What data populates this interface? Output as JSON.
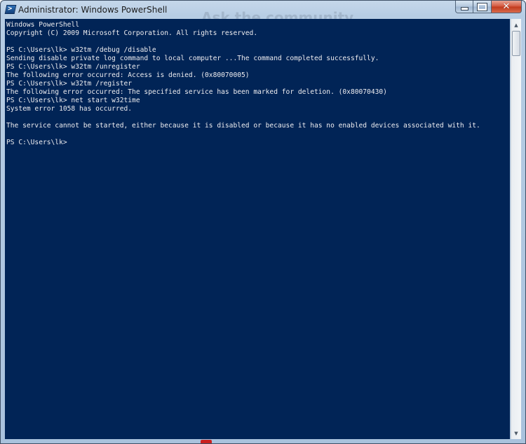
{
  "window": {
    "title": "Administrator: Windows PowerShell",
    "icon": "powershell-icon",
    "background_text": "Ask the community"
  },
  "caption_buttons": {
    "minimize_icon": "minimize-icon",
    "maximize_icon": "maximize-icon",
    "close_icon": "close-icon",
    "close_glyph": "✕"
  },
  "console": {
    "background_color": "#012456",
    "text_color": "#eeedf0",
    "lines": [
      "Windows PowerShell",
      "Copyright (C) 2009 Microsoft Corporation. All rights reserved.",
      "",
      "PS C:\\Users\\lk> w32tm /debug /disable",
      "Sending disable private log command to local computer ...The command completed successfully.",
      "PS C:\\Users\\lk> w32tm /unregister",
      "The following error occurred: Access is denied. (0x80070005)",
      "PS C:\\Users\\lk> w32tm /register",
      "The following error occurred: The specified service has been marked for deletion. (0x80070430)",
      "PS C:\\Users\\lk> net start w32time",
      "System error 1058 has occurred.",
      "",
      "The service cannot be started, either because it is disabled or because it has no enabled devices associated with it.",
      "",
      "PS C:\\Users\\lk>"
    ]
  },
  "scrollbar": {
    "up_arrow": "▲",
    "down_arrow": "▼",
    "position_fraction": 0.0
  }
}
